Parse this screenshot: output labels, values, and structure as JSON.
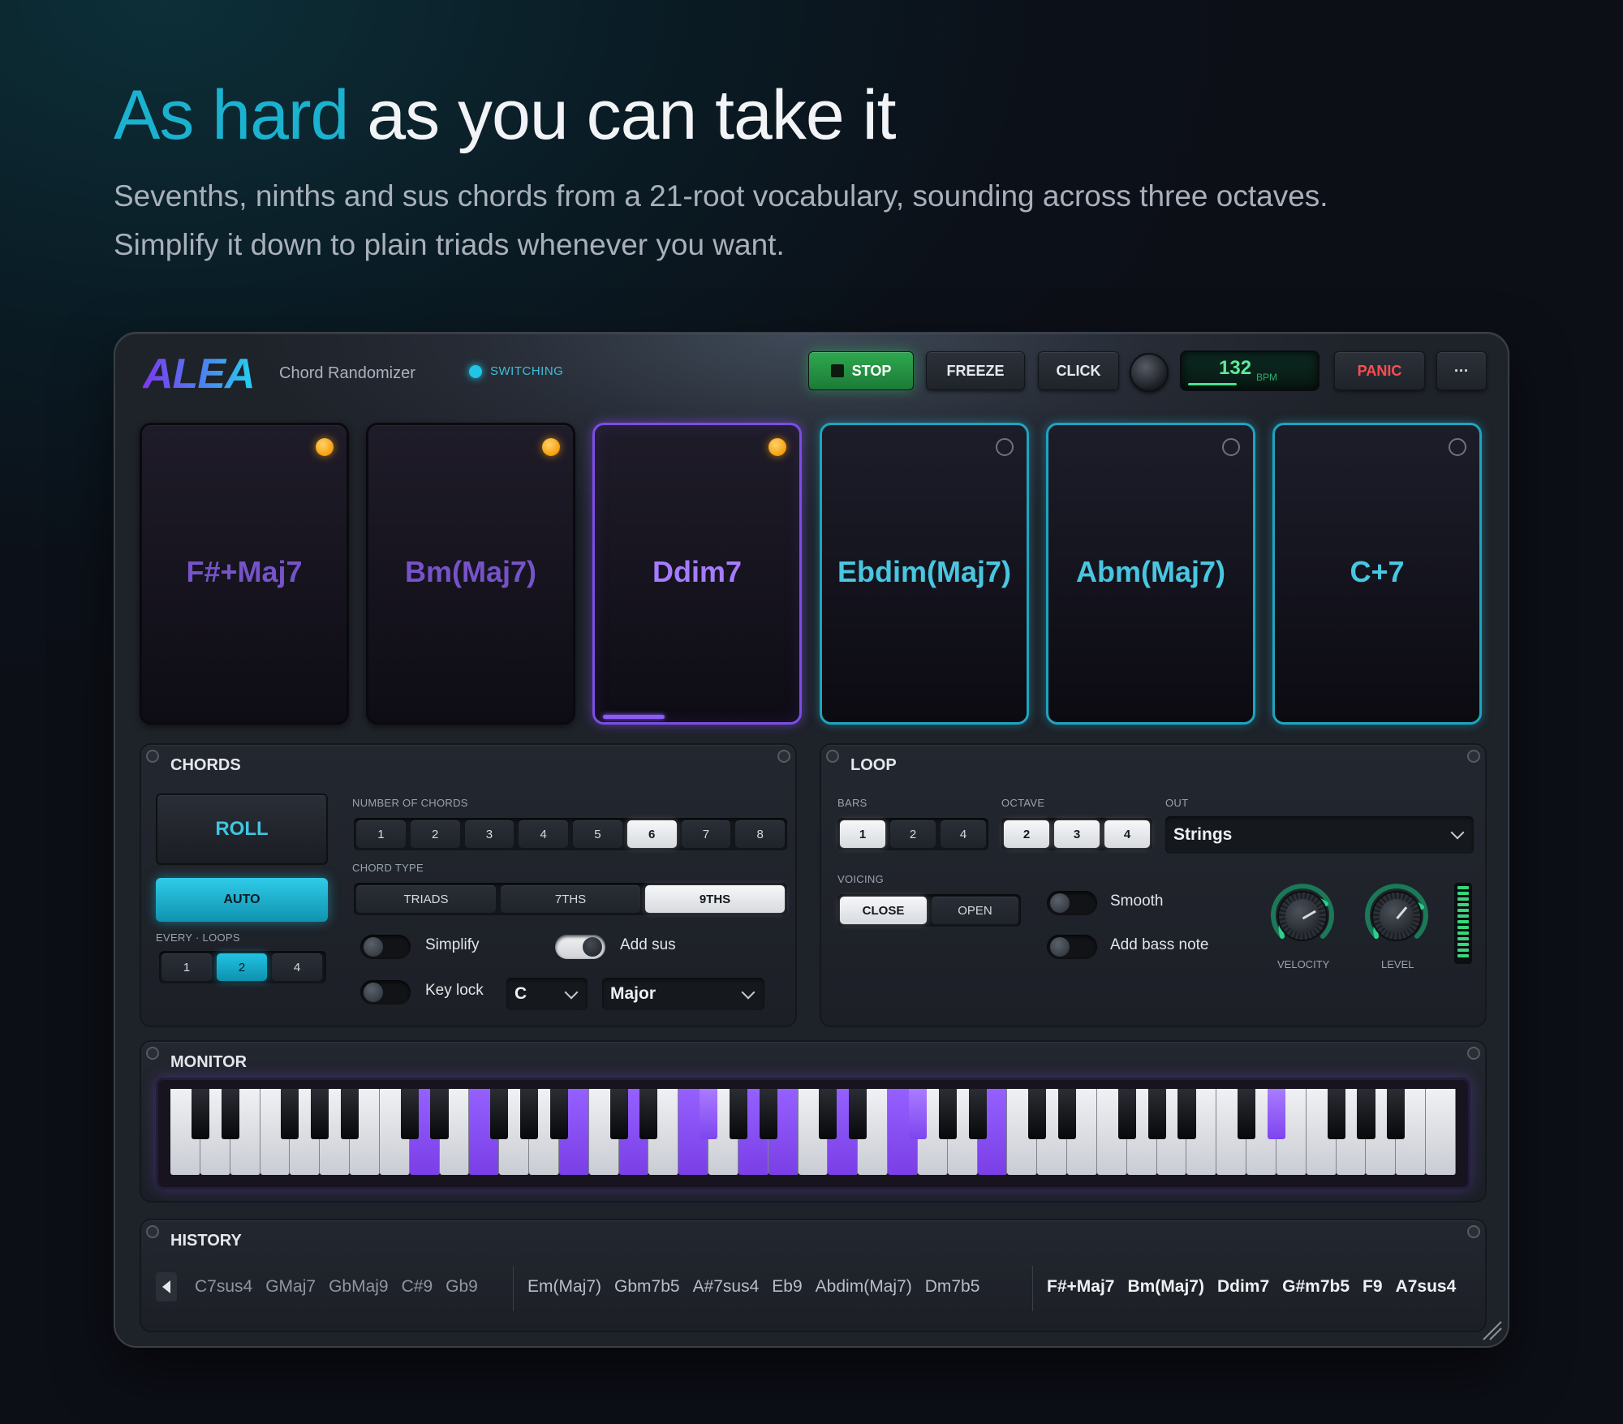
{
  "hero": {
    "title_accent": "As hard",
    "title_rest": "as you can take it",
    "subtitle_line1": "Sevenths, ninths and sus chords from a 21-root vocabulary, sounding across three octaves.",
    "subtitle_line2": "Simplify it down to plain triads whenever you want."
  },
  "header": {
    "logo": "ALEA",
    "app_name": "Chord Randomizer",
    "status": "SWITCHING",
    "stop_label": "STOP",
    "freeze_label": "FREEZE",
    "click_label": "CLICK",
    "bpm_value": "132",
    "bpm_unit": "BPM",
    "panic_label": "PANIC",
    "more_label": "···"
  },
  "pads": [
    {
      "chord": "F#+Maj7",
      "state": "past",
      "led": "on"
    },
    {
      "chord": "Bm(Maj7)",
      "state": "past",
      "led": "on"
    },
    {
      "chord": "Ddim7",
      "state": "current",
      "led": "on",
      "progress": 0.32
    },
    {
      "chord": "Ebdim(Maj7)",
      "state": "next",
      "led": "off"
    },
    {
      "chord": "Abm(Maj7)",
      "state": "next",
      "led": "off"
    },
    {
      "chord": "C+7",
      "state": "next",
      "led": "off"
    }
  ],
  "chords": {
    "title": "CHORDS",
    "roll_label": "ROLL",
    "auto_label": "AUTO",
    "every_loops_label": "EVERY · LOOPS",
    "every_loops_options": [
      "1",
      "2",
      "4"
    ],
    "every_loops_selected": 1,
    "num_chords_label": "NUMBER OF CHORDS",
    "num_chords_options": [
      "1",
      "2",
      "3",
      "4",
      "5",
      "6",
      "7",
      "8"
    ],
    "num_chords_selected": 5,
    "chord_type_label": "CHORD TYPE",
    "chord_type_options": [
      "TRIADS",
      "7THS",
      "9THS"
    ],
    "chord_type_selected": 2,
    "simplify_label": "Simplify",
    "simplify_on": false,
    "add_sus_label": "Add sus",
    "add_sus_on": true,
    "key_lock_label": "Key lock",
    "key_lock_on": false,
    "key_value": "C",
    "scale_value": "Major"
  },
  "loop": {
    "title": "LOOP",
    "bars_label": "BARS",
    "bars_options": [
      "1",
      "2",
      "4"
    ],
    "bars_selected": 0,
    "octave_label": "OCTAVE",
    "octave_options": [
      "2",
      "3",
      "4"
    ],
    "octave_selected": [
      0,
      1,
      2
    ],
    "out_label": "OUT",
    "out_value": "Strings",
    "voicing_label": "VOICING",
    "voicing_options": [
      "CLOSE",
      "OPEN"
    ],
    "voicing_selected": 0,
    "smooth_label": "Smooth",
    "smooth_on": false,
    "bass_label": "Add bass note",
    "bass_on": false,
    "velocity_label": "VELOCITY",
    "level_label": "LEVEL",
    "meter_level": 1.0
  },
  "monitor": {
    "title": "MONITOR",
    "white_key_count": 43,
    "active_white_keys": [
      8,
      10,
      13,
      15,
      17,
      19,
      20,
      22,
      24,
      27
    ],
    "active_black_keys": [
      12,
      17,
      26
    ]
  },
  "history": {
    "title": "HISTORY",
    "old": [
      "C7sus4",
      "GMaj7",
      "GbMaj9",
      "C#9",
      "Gb9"
    ],
    "mid": [
      "Em(Maj7)",
      "Gbm7b5",
      "A#7sus4",
      "Eb9",
      "Abdim(Maj7)",
      "Dm7b5"
    ],
    "new": [
      "F#+Maj7",
      "Bm(Maj7)",
      "Ddim7",
      "G#m7b5",
      "F9",
      "A7sus4"
    ]
  },
  "colors": {
    "accent_cyan": "#22c3e4",
    "accent_purple": "#8b5cf6",
    "stop_green": "#2ea84f",
    "panic_red": "#ff4d4d",
    "led_orange": "#f59e0b"
  }
}
